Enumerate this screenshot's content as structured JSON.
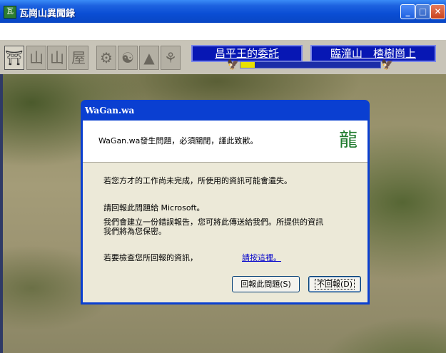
{
  "window": {
    "title": "瓦崗山異聞錄",
    "minimize_label": "_",
    "maximize_label": "□",
    "close_label": "✕"
  },
  "hud": {
    "tools": [
      "⛩",
      "山",
      "山",
      "屋",
      "⚙",
      "☯",
      "▲",
      "⚘"
    ],
    "quest_banner": "昌平王的委託",
    "location_banner": "臨潼山　楂樹崗上",
    "progress": 0.1,
    "left_marker": "🦅",
    "right_marker": "🦅"
  },
  "dialog": {
    "title": "WaGan.wa",
    "header_message": "WaGan.wa發生問題，必須關閉，謹此致歉。",
    "logo_icon": "dragon-icon",
    "logo_glyph": "龍",
    "unsaved_warning": "若您方才的工作尚未完成，所使用的資訊可能會遺失。",
    "report_line1": "請回報此問題給 Microsoft。",
    "report_line2": "我們會建立一份錯誤報告，您可將此傳送給我們。所提供的資訊",
    "report_line3": "我們將為您保密。",
    "view_prompt": "若要檢查您所回報的資訊，",
    "view_link": "請按這裡。",
    "send_button": "回報此問題(S)",
    "dont_send_button": "不回報(D)"
  }
}
